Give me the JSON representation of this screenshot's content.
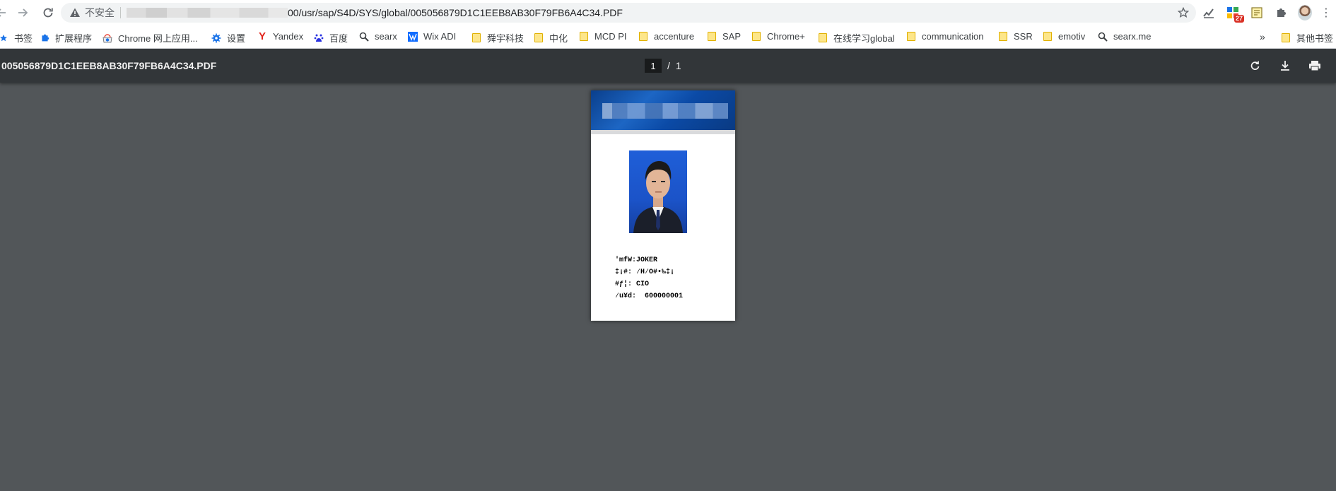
{
  "browser": {
    "address_bar": {
      "security_label": "不安全",
      "url_visible": "00/usr/sap/S4D/SYS/global/005056879D1C1EEB8AB30F79FB6A4C34.PDF"
    },
    "extensions": {
      "badge_count": "27"
    },
    "bookmarks": [
      {
        "label": "书签",
        "icon": "star-icon"
      },
      {
        "label": "扩展程序",
        "icon": "puzzle-icon"
      },
      {
        "label": "Chrome 网上应用...",
        "icon": "chrome-store-icon"
      },
      {
        "label": "设置",
        "icon": "gear-icon"
      },
      {
        "label": "Yandex",
        "icon": "yandex-icon"
      },
      {
        "label": "百度",
        "icon": "baidu-icon"
      },
      {
        "label": "searx",
        "icon": "searx-icon"
      },
      {
        "label": "Wix ADI",
        "icon": "wix-icon"
      },
      {
        "label": "舜宇科技",
        "icon": "folder-icon"
      },
      {
        "label": "中化",
        "icon": "folder-icon"
      },
      {
        "label": "MCD PI",
        "icon": "folder-icon"
      },
      {
        "label": "accenture",
        "icon": "folder-icon"
      },
      {
        "label": "SAP",
        "icon": "folder-icon"
      },
      {
        "label": "Chrome+",
        "icon": "folder-icon"
      },
      {
        "label": "在线学习global",
        "icon": "folder-icon"
      },
      {
        "label": "communication",
        "icon": "folder-icon"
      },
      {
        "label": "SSR",
        "icon": "folder-icon"
      },
      {
        "label": "emotiv",
        "icon": "folder-icon"
      },
      {
        "label": "searx.me",
        "icon": "searx-icon"
      }
    ],
    "bookmarks_more": "»",
    "other_bookmarks": "其他书签"
  },
  "pdf_viewer": {
    "title": "005056879D1C1EEB8AB30F79FB6A4C34.PDF",
    "current_page": "1",
    "page_separator": "/",
    "total_pages": "1",
    "colors": {
      "toolbar": "#323639",
      "background": "#525659"
    }
  },
  "document": {
    "fields": [
      {
        "label": "'mfW:",
        "value": "JOKER"
      },
      {
        "label": "‡¡#:",
        "value": " ⁄H⁄O#•‰‡¡"
      },
      {
        "label": "#ƒ¦:",
        "value": " CIO"
      },
      {
        "label": "⁄u¥d:",
        "value": "  600000001"
      }
    ]
  }
}
